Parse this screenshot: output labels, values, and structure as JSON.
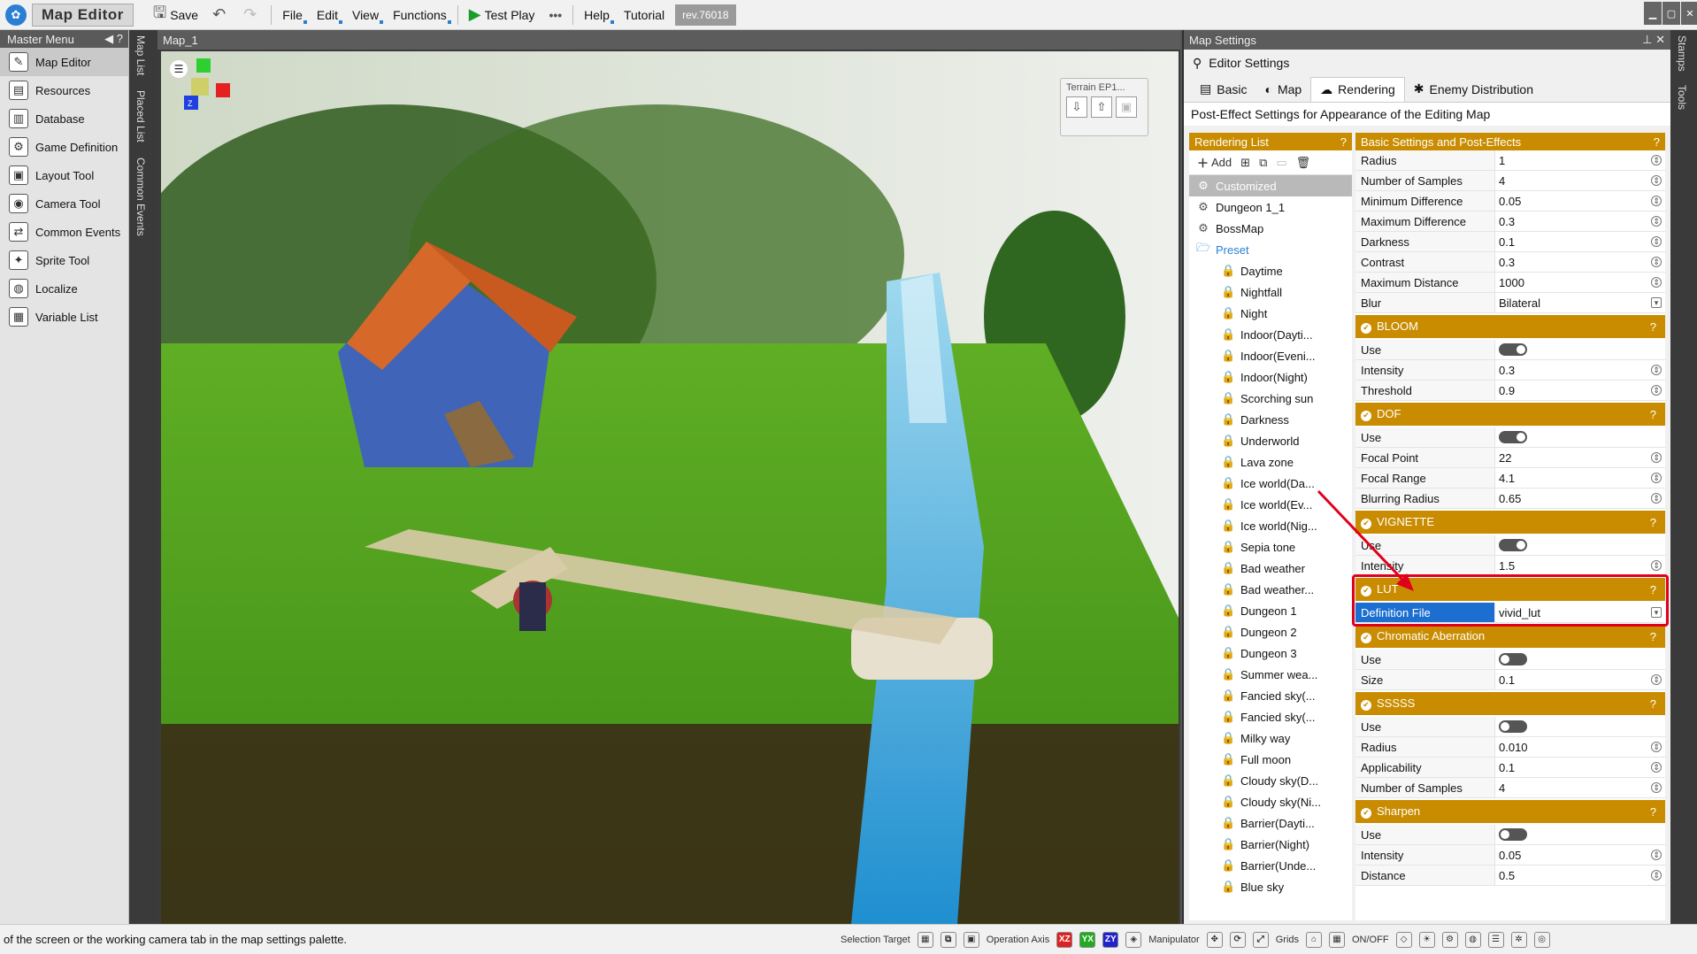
{
  "titlebar": {
    "app_title": "Map Editor",
    "save": "Save",
    "menus": [
      "File",
      "Edit",
      "View",
      "Functions"
    ],
    "test_play": "Test Play",
    "more": "•••",
    "help": "Help",
    "tutorial": "Tutorial",
    "revision": "rev.76018"
  },
  "master_menu": {
    "title": "Master Menu",
    "items": [
      {
        "label": "Map Editor",
        "icon": "map-editor-icon"
      },
      {
        "label": "Resources",
        "icon": "resources-icon"
      },
      {
        "label": "Database",
        "icon": "database-icon"
      },
      {
        "label": "Game Definition",
        "icon": "game-definition-icon"
      },
      {
        "label": "Layout Tool",
        "icon": "layout-tool-icon"
      },
      {
        "label": "Camera Tool",
        "icon": "camera-tool-icon"
      },
      {
        "label": "Common Events",
        "icon": "common-events-icon"
      },
      {
        "label": "Sprite Tool",
        "icon": "sprite-tool-icon"
      },
      {
        "label": "Localize",
        "icon": "localize-icon"
      },
      {
        "label": "Variable List",
        "icon": "variable-list-icon"
      }
    ]
  },
  "vertical_tabs": [
    "Map List",
    "Placed List",
    "Common Events"
  ],
  "right_tabs": [
    "Stamps",
    "Tools"
  ],
  "map_view": {
    "title": "Map_1",
    "terrain_label": "Terrain EP1..."
  },
  "settings": {
    "title": "Map Settings",
    "editor_settings": "Editor Settings",
    "tabs": [
      "Basic",
      "Map",
      "Rendering",
      "Enemy Distribution"
    ],
    "description": "Post-Effect Settings for Appearance of the Editing Map",
    "rendering_list": {
      "title": "Rendering List",
      "help": "?",
      "add": "Add",
      "items": [
        "Customized",
        "Dungeon 1_1",
        "BossMap"
      ],
      "preset_label": "Preset",
      "presets": [
        "Daytime",
        "Nightfall",
        "Night",
        "Indoor(Dayti...",
        "Indoor(Eveni...",
        "Indoor(Night)",
        "Scorching sun",
        "Darkness",
        "Underworld",
        "Lava zone",
        "Ice world(Da...",
        "Ice world(Ev...",
        "Ice world(Nig...",
        "Sepia tone",
        "Bad weather",
        "Bad weather...",
        "Dungeon 1",
        "Dungeon 2",
        "Dungeon 3",
        "Summer wea...",
        "Fancied sky(...",
        "Fancied sky(...",
        "Milky way",
        "Full moon",
        "Cloudy sky(D...",
        "Cloudy sky(Ni...",
        "Barrier(Dayti...",
        "Barrier(Night)",
        "Barrier(Unde...",
        "Blue sky"
      ]
    },
    "basic": {
      "title": "Basic Settings and Post-Effects",
      "help": "?",
      "rows": [
        {
          "k": "Radius",
          "v": "1"
        },
        {
          "k": "Number of Samples",
          "v": "4"
        },
        {
          "k": "Minimum Difference",
          "v": "0.05"
        },
        {
          "k": "Maximum Difference",
          "v": "0.3"
        },
        {
          "k": "Darkness",
          "v": "0.1"
        },
        {
          "k": "Contrast",
          "v": "0.3"
        },
        {
          "k": "Maximum Distance",
          "v": "1000"
        },
        {
          "k": "Blur",
          "v": "Bilateral"
        }
      ]
    },
    "bloom": {
      "title": "BLOOM",
      "help": "?",
      "use": "Use",
      "rows": [
        {
          "k": "Intensity",
          "v": "0.3"
        },
        {
          "k": "Threshold",
          "v": "0.9"
        }
      ]
    },
    "dof": {
      "title": "DOF",
      "help": "?",
      "use": "Use",
      "rows": [
        {
          "k": "Focal Point",
          "v": "22"
        },
        {
          "k": "Focal Range",
          "v": "4.1"
        },
        {
          "k": "Blurring Radius",
          "v": "0.65"
        }
      ]
    },
    "vignette": {
      "title": "VIGNETTE",
      "help": "?",
      "use": "Use",
      "rows": [
        {
          "k": "Intensity",
          "v": "1.5"
        }
      ]
    },
    "lut": {
      "title": "LUT",
      "help": "?",
      "rows": [
        {
          "k": "Definition File",
          "v": "vivid_lut"
        }
      ]
    },
    "chroma": {
      "title": "Chromatic Aberration",
      "help": "?",
      "use": "Use",
      "rows": [
        {
          "k": "Size",
          "v": "0.1"
        }
      ]
    },
    "sssss": {
      "title": "SSSSS",
      "help": "?",
      "use": "Use",
      "rows": [
        {
          "k": "Radius",
          "v": "0.010"
        },
        {
          "k": "Applicability",
          "v": "0.1"
        },
        {
          "k": "Number of Samples",
          "v": "4"
        }
      ]
    },
    "sharpen": {
      "title": "Sharpen",
      "help": "?",
      "use": "Use",
      "rows": [
        {
          "k": "Intensity",
          "v": "0.05"
        },
        {
          "k": "Distance",
          "v": "0.5"
        }
      ]
    }
  },
  "status": {
    "message": "of the screen or the working camera tab in the map settings palette.",
    "selection_target": "Selection Target",
    "operation_axis": "Operation Axis",
    "axes": [
      "XZ",
      "YX",
      "ZY"
    ],
    "manipulator": "Manipulator",
    "grids": "Grids",
    "onoff": "ON/OFF"
  },
  "colors": {
    "accent": "#c98c00",
    "highlight": "#1c6fd0",
    "callout": "#e0001b"
  }
}
